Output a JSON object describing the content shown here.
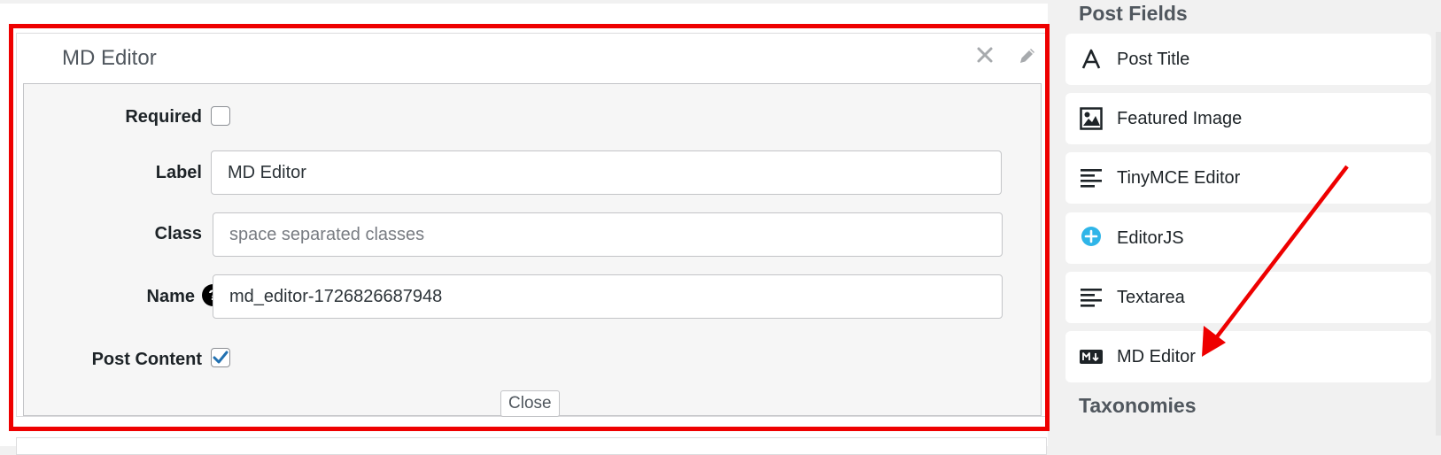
{
  "field_panel": {
    "title": "MD Editor",
    "required_label": "Required",
    "required_checked": false,
    "label_label": "Label",
    "label_value": "MD Editor",
    "class_label": "Class",
    "class_placeholder": "space separated classes",
    "name_label": "Name",
    "name_help_glyph": "?",
    "name_value": "md_editor-1726826687948",
    "post_content_label": "Post Content",
    "post_content_checked": true,
    "close_button": "Close"
  },
  "sidebar": {
    "post_fields_heading": "Post Fields",
    "items": [
      {
        "label": "Post Title",
        "icon": "letter-a-icon"
      },
      {
        "label": "Featured Image",
        "icon": "image-icon"
      },
      {
        "label": "TinyMCE Editor",
        "icon": "text-align-icon"
      },
      {
        "label": "EditorJS",
        "icon": "plus-circle-icon"
      },
      {
        "label": "Textarea",
        "icon": "text-align-icon"
      },
      {
        "label": "MD Editor",
        "icon": "markdown-icon"
      }
    ],
    "taxonomies_heading": "Taxonomies"
  },
  "colors": {
    "highlight": "#ee0000",
    "annotation_arrow": "#ee0000",
    "checkbox_check": "#2271b1",
    "editorjs_icon": "#2fb5e8"
  }
}
